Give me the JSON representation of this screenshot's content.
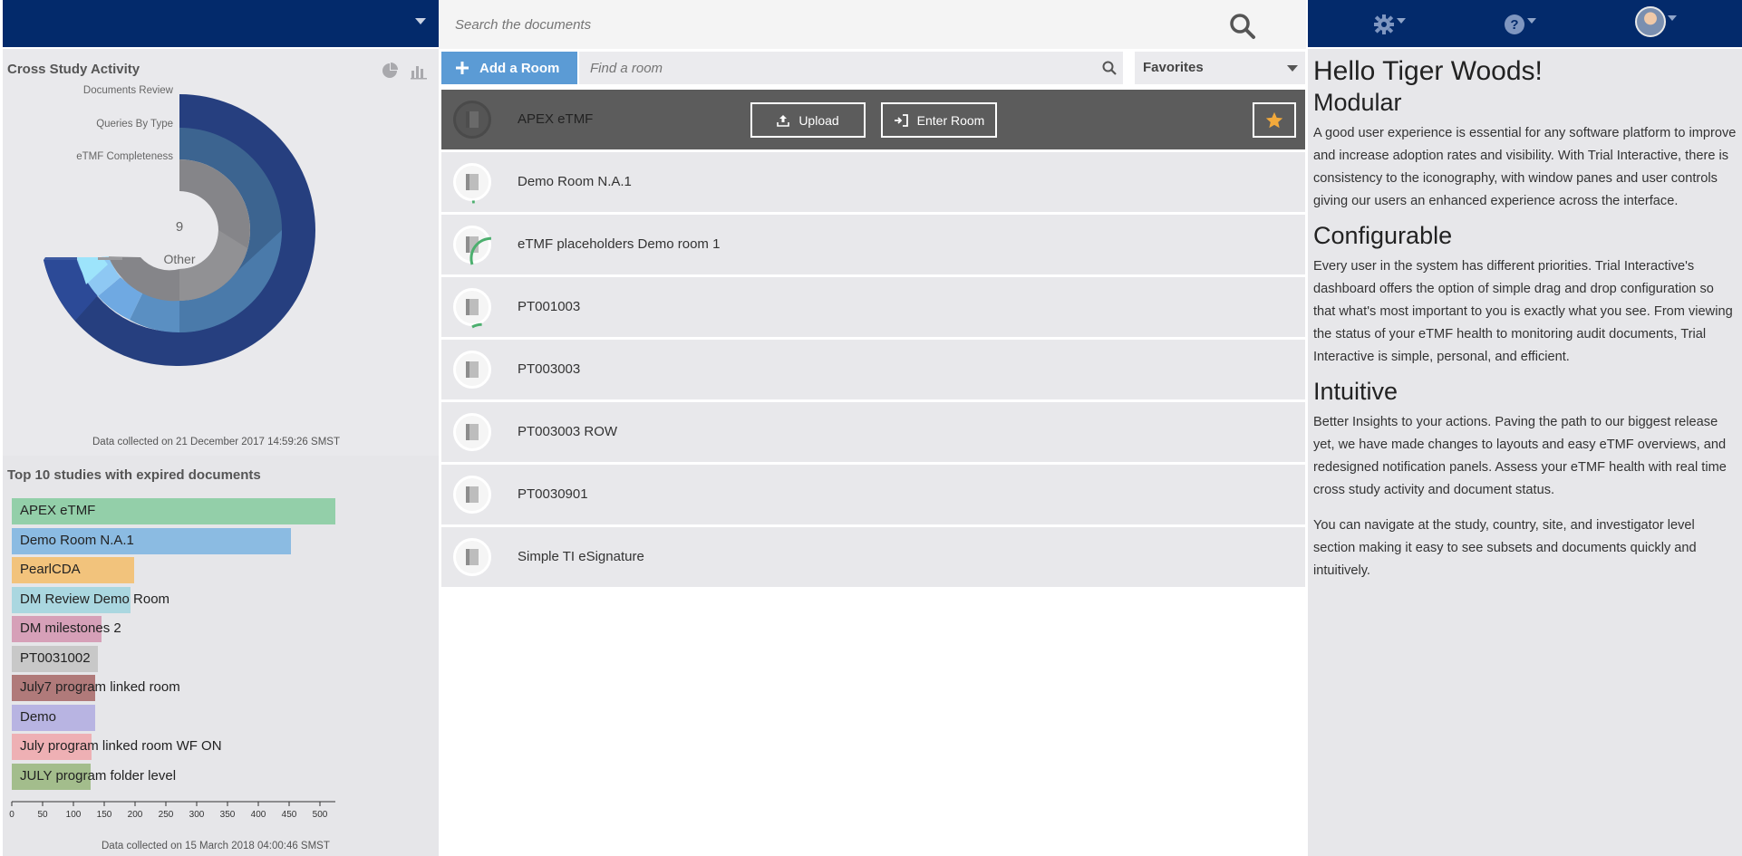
{
  "topbar": {
    "search_placeholder": "Search the documents",
    "icons": [
      "chevron-down-icon",
      "search-icon",
      "gear-icon",
      "help-icon",
      "user-avatar"
    ]
  },
  "cross_study": {
    "title": "Cross Study Activity",
    "labels": [
      "Documents Review",
      "Queries By Type",
      "eTMF Completeness"
    ],
    "center_value": "9",
    "center_label": "Other",
    "collected": "Data collected on 21 December 2017 14:59:26 SMST"
  },
  "expired": {
    "title": "Top 10 studies with expired documents",
    "collected": "Data collected on 15 March 2018 04:00:46 SMST"
  },
  "chart_data": {
    "type": "bar",
    "categories": [
      "APEX eTMF",
      "Demo Room N.A.1",
      "PearlCDA",
      "DM Review Demo Room",
      "DM milestones 2",
      "PT0031002",
      "July7 program linked room",
      "Demo",
      "July program linked room WF ON",
      "JULY program folder level"
    ],
    "values": [
      525,
      453,
      198,
      192,
      145,
      140,
      135,
      135,
      130,
      128
    ],
    "colors": [
      "#93cfa9",
      "#8bbbe2",
      "#f2c37c",
      "#aad7e0",
      "#d6a0b8",
      "#c8c8c8",
      "#b07a7a",
      "#b8b4e2",
      "#eeb0b4",
      "#a3bd8c"
    ],
    "xticks": [
      0,
      50,
      100,
      150,
      200,
      250,
      300,
      350,
      400,
      450,
      500
    ],
    "xlim": [
      0,
      525
    ],
    "orientation": "horizontal"
  },
  "rooms_toolbar": {
    "add_label": "Add a Room",
    "find_placeholder": "Find a room",
    "favorites_label": "Favorites"
  },
  "rooms": [
    {
      "name": "APEX eTMF",
      "active": true,
      "progress": 0
    },
    {
      "name": "Demo Room N.A.1",
      "active": false,
      "progress": 0.02
    },
    {
      "name": "eTMF placeholders Demo room 1",
      "active": false,
      "progress": 0.3
    },
    {
      "name": "PT001003",
      "active": false,
      "progress": 0.08
    },
    {
      "name": "PT003003",
      "active": false,
      "progress": 0
    },
    {
      "name": "PT003003 ROW",
      "active": false,
      "progress": 0
    },
    {
      "name": "PT0030901",
      "active": false,
      "progress": 0
    },
    {
      "name": "Simple TI eSignature",
      "active": false,
      "progress": 0
    }
  ],
  "room_actions": {
    "upload_label": "Upload",
    "enter_label": "Enter Room"
  },
  "welcome": {
    "greeting": "Hello Tiger Woods!",
    "h_modular": "Modular",
    "p_modular": "A good user experience is essential for any software platform to improve and increase adoption rates and visibility. With Trial Interactive, there is consistency to the iconography, with window panes and user controls giving our users an enhanced experience across the interface.",
    "h_configurable": "Configurable",
    "p_configurable": "Every user in the system has different priorities. Trial Interactive's dashboard offers the option of simple drag and drop configuration so that what's most important to you is exactly what you see. From viewing the status of your eTMF health to monitoring audit documents, Trial Interactive is simple, personal, and efficient.",
    "h_intuitive": "Intuitive",
    "p_intuitive": "Better Insights to your actions. Paving the path to our biggest release yet, we have made changes to layouts and easy eTMF overviews, and redesigned notification panels. Assess your eTMF health with real time cross study activity and document status.",
    "p_navigate": "You can navigate at the study, country, site, and investigator level section making it easy to see subsets and documents quickly and intuitively."
  }
}
